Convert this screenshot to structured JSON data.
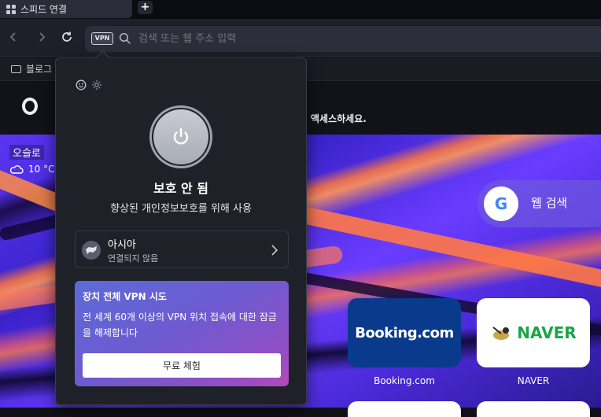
{
  "tab": {
    "title": "스피드 연결",
    "new_tab": "+"
  },
  "toolbar": {
    "back": "‹",
    "forward": "›",
    "reload": "↻",
    "vpn_badge": "VPN",
    "url_placeholder": "검색 또는 웹 주소 입력"
  },
  "bookmarks": {
    "folder_label": "블로그"
  },
  "speed_dial": {
    "header_text": "액세스하세요.",
    "weather_city": "오슬로",
    "weather_temp": "10 °C",
    "web_search_label": "웹 검색",
    "google_letter": "G",
    "tiles": [
      {
        "logo": "Booking.com",
        "label": "Booking.com"
      },
      {
        "logo": "NAVER",
        "label": "NAVER"
      }
    ]
  },
  "vpn_popup": {
    "status_title": "보호 안 됨",
    "status_subtitle": "향상된 개인정보보호를 위해 사용",
    "location_name": "아시아",
    "location_status": "연결되지 않음",
    "promo_title": "장치 전체 VPN 시도",
    "promo_text": "전 세계 60개 이상의 VPN 위치 접속에 대한 잠금을 해제합니다",
    "promo_button": "무료 체험"
  },
  "colors": {
    "popup_bg": "#1f2129",
    "promo_gradient_start": "#5b6bd8",
    "promo_gradient_end": "#b24ab8",
    "booking_blue": "#0a3a8c",
    "naver_green": "#1aa449"
  }
}
